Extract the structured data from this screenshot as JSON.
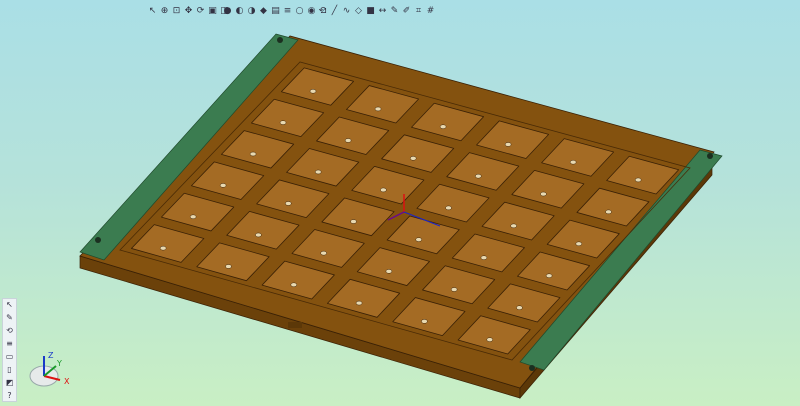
{
  "toolbar_left": [
    "select-arrow-icon",
    "zoom-icon",
    "zoom-window-icon",
    "pan-icon",
    "rotate-icon",
    "fit-icon",
    "view-cube-icon"
  ],
  "toolbar_middle": [
    "bulb-icon",
    "display-mode-icon",
    "section-icon",
    "color-icon",
    "shading-icon",
    "layer-icon",
    "hide-icon",
    "show-icon",
    "measure-icon"
  ],
  "toolbar_right": [
    "undo-icon",
    "line-icon",
    "curve-icon",
    "surface-icon",
    "solid-icon",
    "dimension-icon",
    "annotation-icon",
    "pencil-icon",
    "analysis-icon",
    "grid-icon"
  ],
  "left_toolbar": [
    "pick-icon",
    "edit-icon",
    "rotate-view-icon",
    "layers-icon",
    "top-view-icon",
    "front-view-icon",
    "iso-view-icon",
    "help-icon"
  ],
  "triad": {
    "x": "X",
    "y": "Y",
    "z": "Z"
  },
  "colors": {
    "plate": "#84520f",
    "pocket": "#a46b24",
    "rail": "#3b7c50",
    "edge": "#3a2106"
  }
}
